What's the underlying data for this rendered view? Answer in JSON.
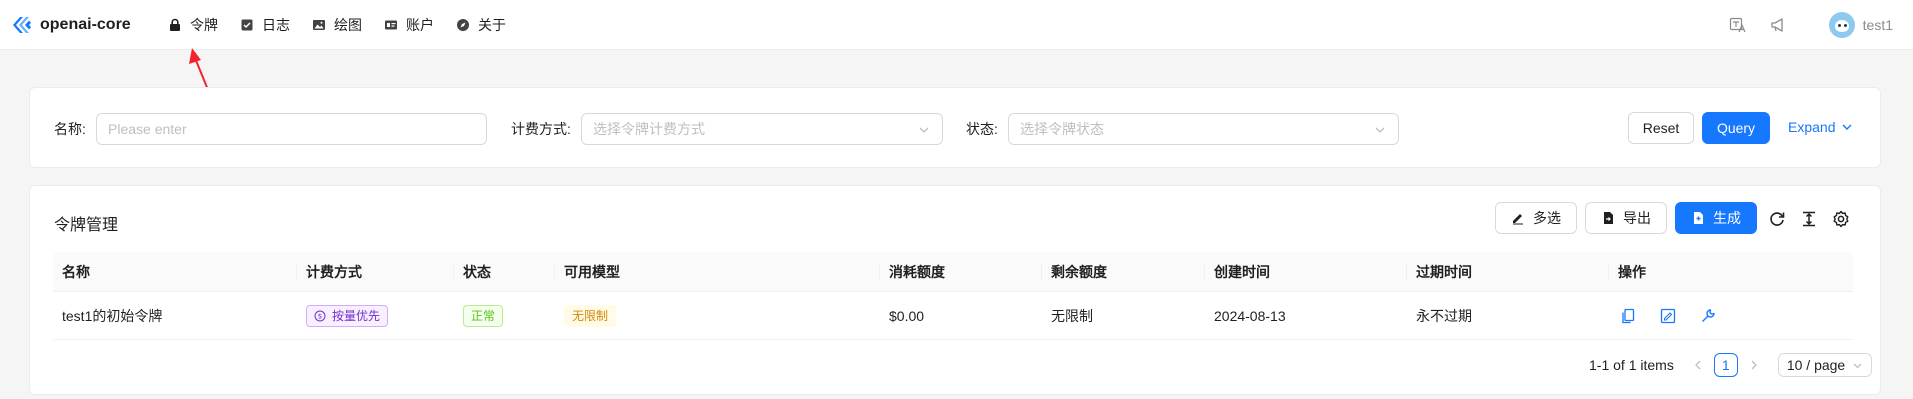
{
  "brand": {
    "name": "openai-core",
    "accent": "#1677ff"
  },
  "nav": {
    "items": [
      {
        "label": "令牌",
        "icon": "lock-icon"
      },
      {
        "label": "日志",
        "icon": "checkbox-icon"
      },
      {
        "label": "绘图",
        "icon": "image-icon"
      },
      {
        "label": "账户",
        "icon": "id-card-icon"
      },
      {
        "label": "关于",
        "icon": "compass-icon"
      }
    ]
  },
  "header": {
    "username": "test1",
    "icons": [
      "translate-icon",
      "notification-icon"
    ]
  },
  "search": {
    "name_label": "名称:",
    "name_placeholder": "Please enter",
    "billing_label": "计费方式:",
    "billing_placeholder": "选择令牌计费方式",
    "status_label": "状态:",
    "status_placeholder": "选择令牌状态",
    "reset_label": "Reset",
    "query_label": "Query",
    "expand_label": "Expand"
  },
  "table_card": {
    "title": "令牌管理",
    "multi_select_label": "多选",
    "export_label": "导出",
    "generate_label": "生成",
    "tool_icons": [
      "reload-icon",
      "column-height-icon",
      "setting-icon"
    ]
  },
  "table": {
    "columns": [
      "名称",
      "计费方式",
      "状态",
      "可用模型",
      "消耗额度",
      "剩余额度",
      "创建时间",
      "过期时间",
      "操作"
    ],
    "rows": [
      {
        "name": "test1的初始令牌",
        "billing": "按量优先",
        "status": "正常",
        "models": "无限制",
        "consumed": "$0.00",
        "remaining": "无限制",
        "created": "2024-08-13",
        "expires": "永不过期",
        "actions": [
          "copy-icon",
          "edit-icon",
          "tool-icon"
        ]
      }
    ]
  },
  "pagination": {
    "summary": "1-1 of 1 items",
    "current_page": "1",
    "page_size": "10 / page"
  },
  "colors": {
    "primary": "#1677ff",
    "tag_purple": "#722ed1",
    "tag_green": "#52c41a",
    "tag_orange": "#d48806",
    "annotation_arrow": "#f5222d"
  }
}
